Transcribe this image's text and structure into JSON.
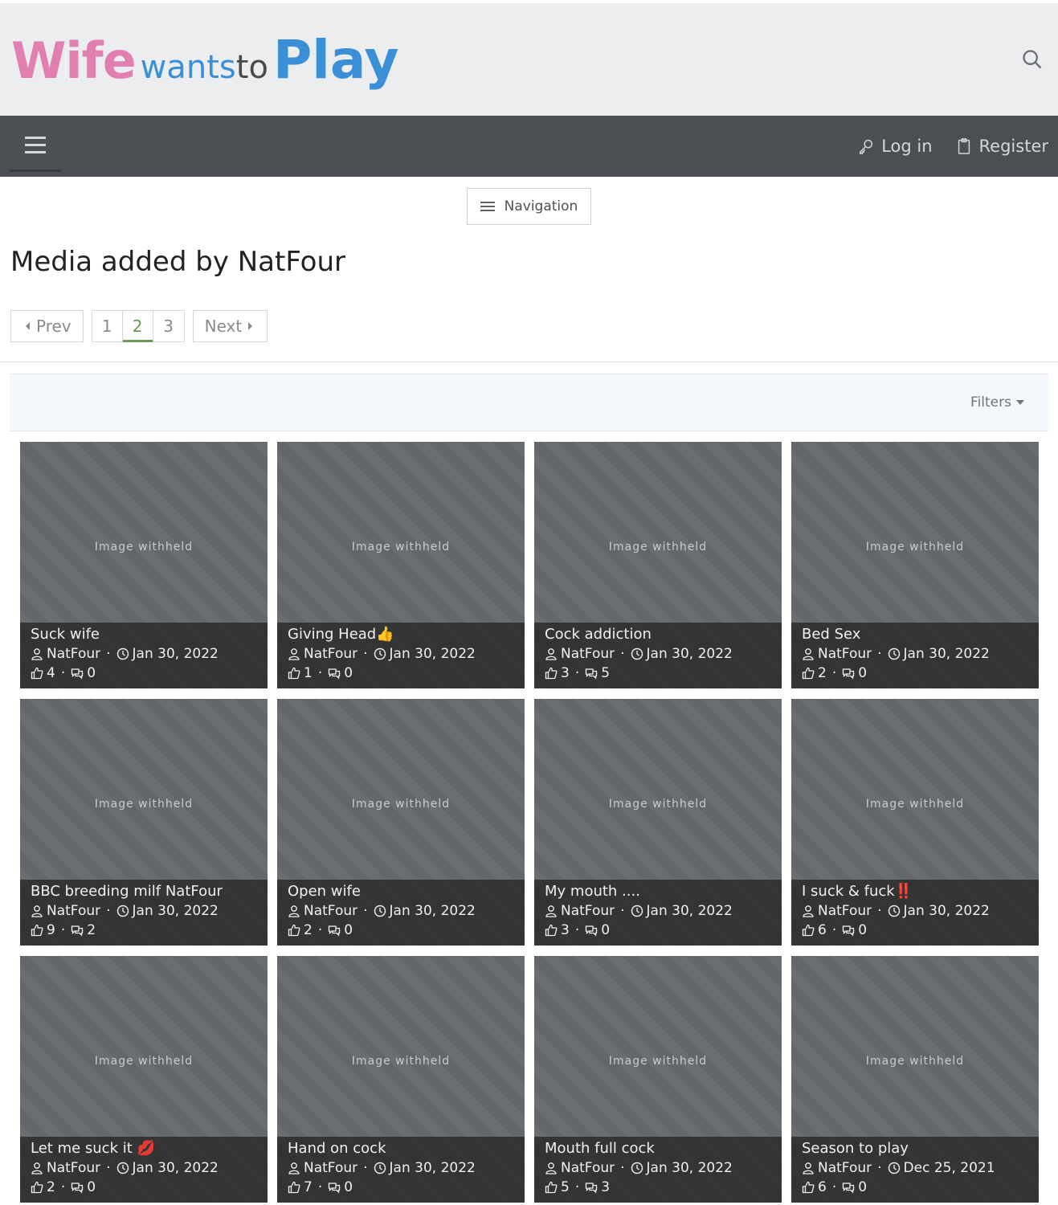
{
  "site": {
    "logo": {
      "part1": "Wife",
      "part2": "wants",
      "part3": "to",
      "part4": "Play"
    },
    "search_icon": "search-icon"
  },
  "navbar": {
    "menu_icon": "hamburger-icon",
    "login_label": "Log in",
    "login_icon": "key-icon",
    "register_label": "Register",
    "register_icon": "clipboard-icon"
  },
  "navigation_button": {
    "label": "Navigation",
    "icon": "hamburger-icon"
  },
  "page": {
    "title": "Media added by NatFour"
  },
  "pagination": {
    "prev_label": "Prev",
    "next_label": "Next",
    "pages": [
      "1",
      "2",
      "3"
    ],
    "current_page": "2"
  },
  "filters": {
    "label": "Filters"
  },
  "colors": {
    "navbar_bg": "#4b4e52",
    "header_bg": "#ecedef",
    "active_page": "#6a9a55",
    "logo_pink": "#e07fb0",
    "logo_blue": "#3a8fd6"
  },
  "media": {
    "placeholder_text": "Image withheld",
    "items": [
      {
        "title": "Suck wife",
        "author": "NatFour",
        "date": "Jan 30, 2022",
        "likes": "4",
        "comments": "0"
      },
      {
        "title": "Giving Head👍",
        "author": "NatFour",
        "date": "Jan 30, 2022",
        "likes": "1",
        "comments": "0"
      },
      {
        "title": "Cock addiction",
        "author": "NatFour",
        "date": "Jan 30, 2022",
        "likes": "3",
        "comments": "5"
      },
      {
        "title": "Bed Sex",
        "author": "NatFour",
        "date": "Jan 30, 2022",
        "likes": "2",
        "comments": "0"
      },
      {
        "title": "BBC breeding milf NatFour",
        "author": "NatFour",
        "date": "Jan 30, 2022",
        "likes": "9",
        "comments": "2"
      },
      {
        "title": "Open wife",
        "author": "NatFour",
        "date": "Jan 30, 2022",
        "likes": "2",
        "comments": "0"
      },
      {
        "title": "My mouth ....",
        "author": "NatFour",
        "date": "Jan 30, 2022",
        "likes": "3",
        "comments": "0"
      },
      {
        "title": "I suck & fuck‼️",
        "author": "NatFour",
        "date": "Jan 30, 2022",
        "likes": "6",
        "comments": "0"
      },
      {
        "title": "Let me suck it 💋",
        "author": "NatFour",
        "date": "Jan 30, 2022",
        "likes": "2",
        "comments": "0"
      },
      {
        "title": "Hand on cock",
        "author": "NatFour",
        "date": "Jan 30, 2022",
        "likes": "7",
        "comments": "0"
      },
      {
        "title": "Mouth full cock",
        "author": "NatFour",
        "date": "Jan 30, 2022",
        "likes": "5",
        "comments": "3"
      },
      {
        "title": "Season to play",
        "author": "NatFour",
        "date": "Dec 25, 2021",
        "likes": "6",
        "comments": "0"
      }
    ]
  }
}
